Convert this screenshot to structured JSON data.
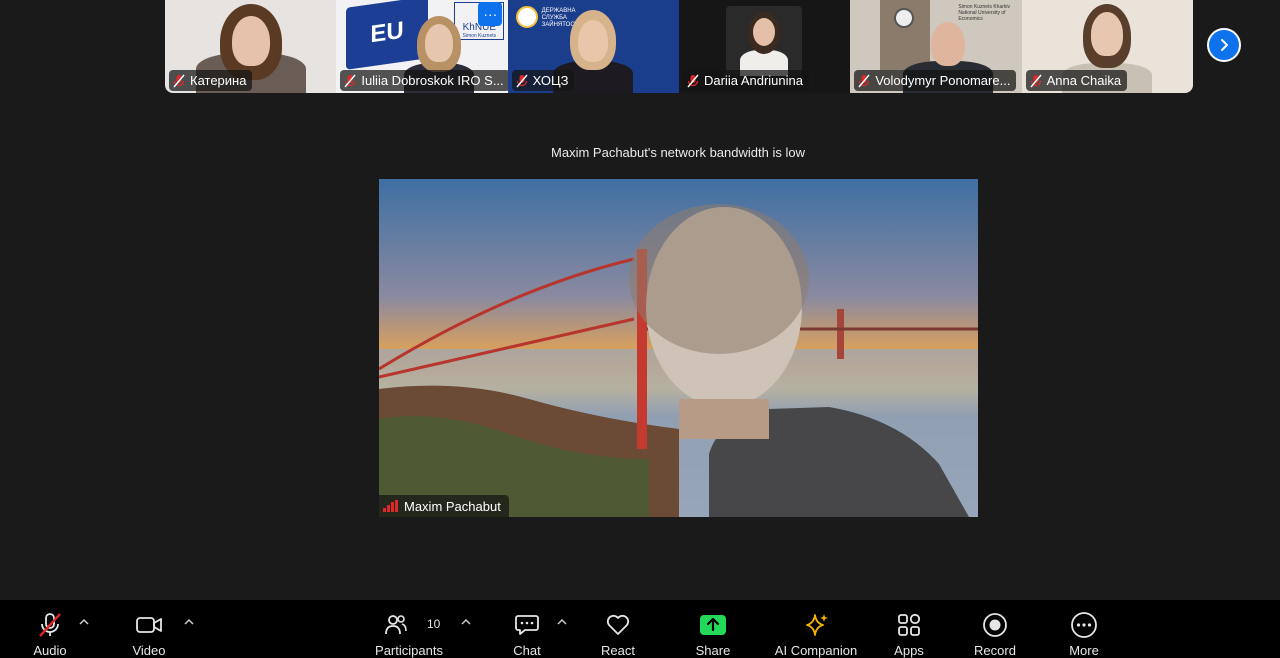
{
  "participants": [
    {
      "name": "Катерина",
      "bg": "#e8e6e4"
    },
    {
      "name": "Iuliia Dobroskok IRO S...",
      "bg": "#f2f2f4"
    },
    {
      "name": "ХОЦЗ",
      "bg": "#1b3e8c"
    },
    {
      "name": "Dariia Andriunina",
      "bg": "#161616"
    },
    {
      "name": "Volodymyr Ponomare...",
      "bg": "#cfc8be"
    },
    {
      "name": "Anna Chaika",
      "bg": "#e9e3da"
    }
  ],
  "tile_texts": {
    "eu": "EU",
    "khnue": "KhNUE",
    "khnue_sub": "Simon Kuznets",
    "service": "ДЕРЖАВНА СЛУЖБА ЗАЙНЯТОСТІ",
    "univ": "Simon Kuznets Kharkiv National University of Economics"
  },
  "notice": "Maxim Pachabut's network bandwidth is low",
  "speaker": {
    "name": "Maxim Pachabut"
  },
  "toolbar": {
    "audio": "Audio",
    "video": "Video",
    "participants": "Participants",
    "participants_count": "10",
    "chat": "Chat",
    "react": "React",
    "share": "Share",
    "ai": "AI Companion",
    "apps": "Apps",
    "record": "Record",
    "more": "More"
  },
  "colors": {
    "accent": "#0e72ed",
    "share": "#23d959",
    "muted": "#e02828",
    "ai": "#f5b400"
  }
}
